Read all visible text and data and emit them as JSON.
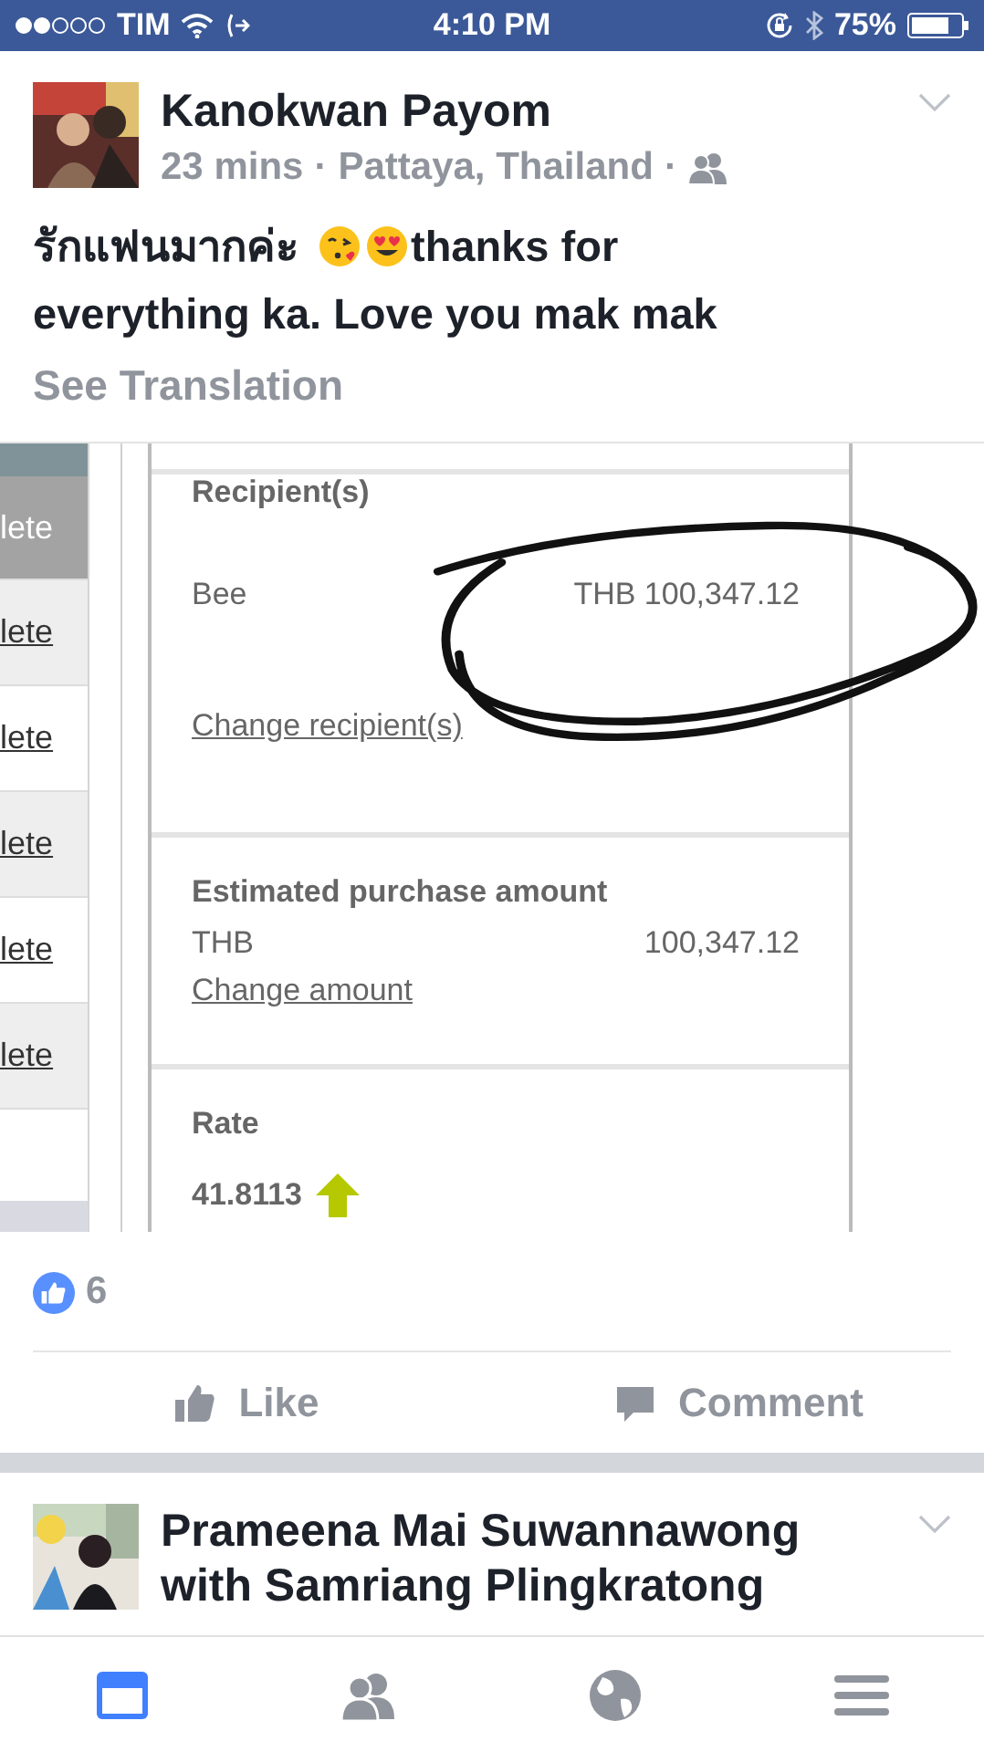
{
  "status_bar": {
    "carrier": "TIM",
    "time": "4:10 PM",
    "battery": "75%"
  },
  "post": {
    "author": "Kanokwan Payom",
    "meta": [
      "23 mins",
      "·",
      "Pattaya, Thailand",
      "·"
    ],
    "message": [
      {
        "kind": "text",
        "text": "รักแฟนมากค่ะ"
      },
      {
        "kind": "kiss"
      },
      {
        "kind": "heart-eyes"
      },
      {
        "kind": "text",
        "text": "thanks for"
      },
      {
        "kind": "text",
        "text": "everything ka. Love you mak mak"
      }
    ],
    "see_translation": "See Translation",
    "attachment": {
      "delete_links": [
        {
          "text": "lete",
          "highlighted": true
        },
        {
          "text": "lete",
          "highlighted": false
        },
        {
          "text": "lete",
          "highlighted": false
        },
        {
          "text": "lete",
          "highlighted": false
        },
        {
          "text": "lete",
          "highlighted": false
        },
        {
          "text": "lete",
          "highlighted": false
        }
      ],
      "recipient": {
        "title": "Recipient(s)",
        "name": "Bee",
        "amount": "THB 100,347.12",
        "link": "Change recipient(s)"
      },
      "estimate": {
        "title": "Estimated purchase amount",
        "currency": "THB",
        "amount": "100,347.12",
        "link": "Change amount"
      },
      "rate": {
        "title": "Rate",
        "value": "41.8113",
        "rising": true
      }
    },
    "reactions": {
      "count": "6"
    },
    "actions": [
      {
        "kind": "like",
        "label": "Like"
      },
      {
        "kind": "comment",
        "label": "Comment"
      }
    ]
  },
  "next_post": {
    "author": "Prameena Mai Suwannawong",
    "with_line": "with Samriang Plingkratong"
  },
  "tab_bar": [
    {
      "kind": "feed",
      "selected": true
    },
    {
      "kind": "friends",
      "selected": false
    },
    {
      "kind": "globe",
      "selected": false
    },
    {
      "kind": "menu",
      "selected": false
    }
  ]
}
